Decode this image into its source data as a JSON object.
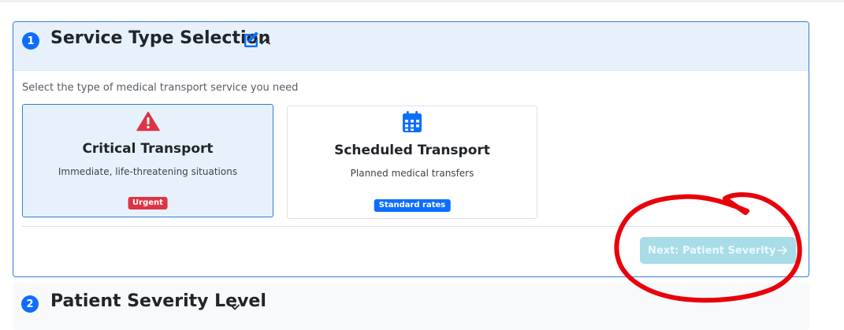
{
  "section1": {
    "step": "1",
    "title": "Service Type Selection",
    "instruction": "Select the type of medical transport service you need",
    "options": [
      {
        "title": "Critical Transport",
        "description": "Immediate, life-threatening situations",
        "badge": "Urgent",
        "icon": "warning-triangle-icon",
        "selected": true
      },
      {
        "title": "Scheduled Transport",
        "description": "Planned medical transfers",
        "badge": "Standard rates",
        "icon": "calendar-icon",
        "selected": false
      }
    ],
    "next_button": "Next: Patient Severity"
  },
  "section2": {
    "step": "2",
    "title": "Patient Severity Level"
  },
  "colors": {
    "primary": "#0d6efd",
    "danger": "#dc3545",
    "selected_bg": "#e7f1fc",
    "disabled_button": "#a8dce6",
    "annotation": "#e8000b"
  }
}
